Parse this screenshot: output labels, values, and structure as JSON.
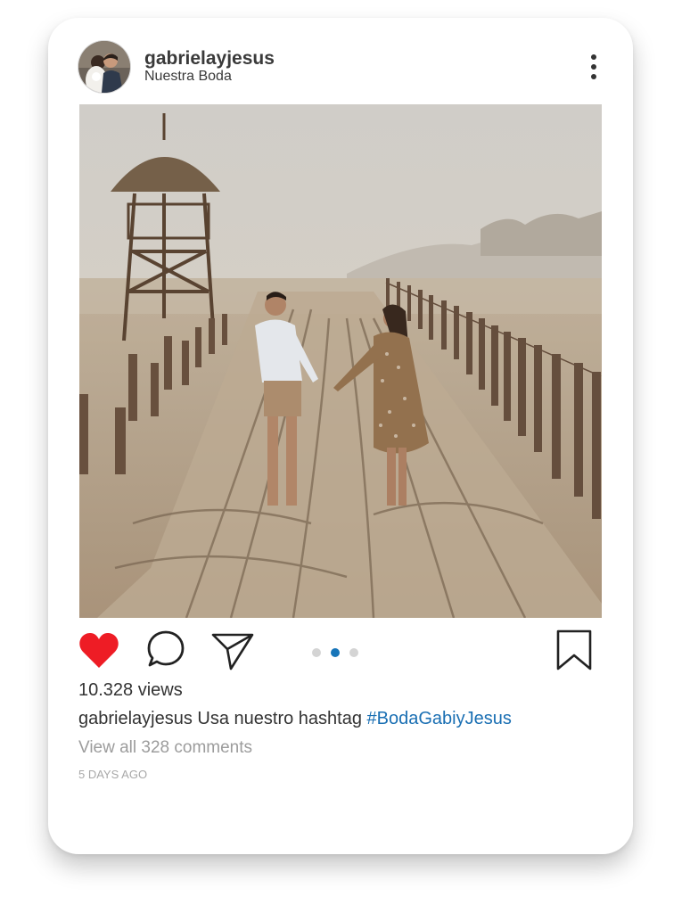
{
  "post": {
    "username": "gabrielayjesus",
    "location": "Nuestra Boda",
    "views": "10.328 views",
    "caption_user": "gabrielayjesus",
    "caption_text": " Usa nuestro hashtag ",
    "caption_hashtag": "#BodaGabiyJesus",
    "view_comments": "View all 328 comments",
    "timestamp": "5 DAYS AGO",
    "liked": true,
    "carousel": {
      "total": 3,
      "active_index": 1
    }
  },
  "colors": {
    "like": "#ee1c25",
    "hashtag": "#1a6fb3",
    "active_dot": "#1775b9"
  },
  "icons": {
    "more": "more-vertical-icon",
    "like": "heart-icon",
    "comment": "comment-bubble-icon",
    "share": "paper-plane-icon",
    "save": "bookmark-icon"
  }
}
